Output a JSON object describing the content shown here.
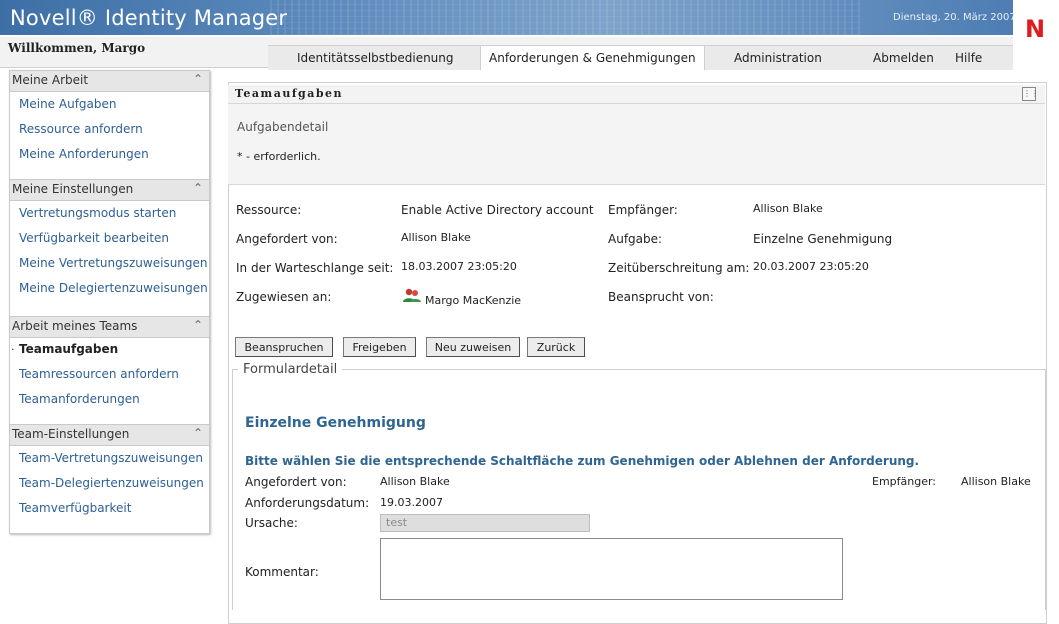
{
  "header": {
    "app_title": "Novell® Identity Manager",
    "date": "Dienstag, 20. März 2007",
    "logo_letter": "N",
    "welcome": "Willkommen, Margo"
  },
  "nav": {
    "tabs": [
      {
        "label": "Identitätsselbstbedienung"
      },
      {
        "label": "Anforderungen & Genehmigungen",
        "active": true
      },
      {
        "label": "Administration"
      },
      {
        "label": "Abmelden"
      },
      {
        "label": "Hilfe"
      }
    ]
  },
  "sidebar": {
    "sections": [
      {
        "title": "Meine Arbeit",
        "items": [
          "Meine Aufgaben",
          "Ressource anfordern",
          "Meine Anforderungen"
        ]
      },
      {
        "title": "Meine Einstellungen",
        "items": [
          "Vertretungsmodus starten",
          "Verfügbarkeit bearbeiten",
          "Meine Vertretungszuweisungen",
          "Meine Delegiertenzuweisungen"
        ]
      },
      {
        "title": "Arbeit meines Teams",
        "items": [
          "Teamaufgaben",
          "Teamressourcen anfordern",
          "Teamanforderungen"
        ]
      },
      {
        "title": "Team-Einstellungen",
        "items": [
          "Team-Vertretungszuweisungen",
          "Team-Delegiertenzuweisungen",
          "Teamverfügbarkeit"
        ]
      }
    ],
    "current_item": "Teamaufgaben"
  },
  "panel": {
    "title": "Teamaufgaben",
    "task_detail": "Aufgabendetail",
    "required_note": "* - erforderlich."
  },
  "task": {
    "resource_label": "Ressource:",
    "resource_value": "Enable Active Directory account",
    "recipient_label": "Empfänger:",
    "recipient_value": "Allison Blake",
    "requested_by_label": "Angefordert von:",
    "requested_by_value": "Allison Blake",
    "task_label": "Aufgabe:",
    "task_value": "Einzelne Genehmigung",
    "queue_label": "In der Warteschlange seit:",
    "queue_value": "18.03.2007 23:05:20",
    "timeout_label": "Zeitüberschreitung am:",
    "timeout_value": "20.03.2007 23:05:20",
    "assigned_label": "Zugewiesen an:",
    "assigned_value": "Margo MacKenzie",
    "claimed_label": "Beansprucht von:"
  },
  "buttons": {
    "claim": "Beanspruchen",
    "release": "Freigeben",
    "reassign": "Neu zuweisen",
    "back": "Zurück"
  },
  "form": {
    "legend": "Formulardetail",
    "heading": "Einzelne Genehmigung",
    "instruction": "Bitte wählen Sie die entsprechende Schaltfläche zum Genehmigen oder Ablehnen der Anforderung.",
    "requested_by_label": "Angefordert von:",
    "requested_by_value": "Allison Blake",
    "recipient_label": "Empfänger:",
    "recipient_value": "Allison Blake",
    "request_date_label": "Anforderungsdatum:",
    "request_date_value": "19.03.2007",
    "reason_label": "Ursache:",
    "reason_value": "test",
    "comment_label": "Kommentar:",
    "comment_value": ""
  }
}
